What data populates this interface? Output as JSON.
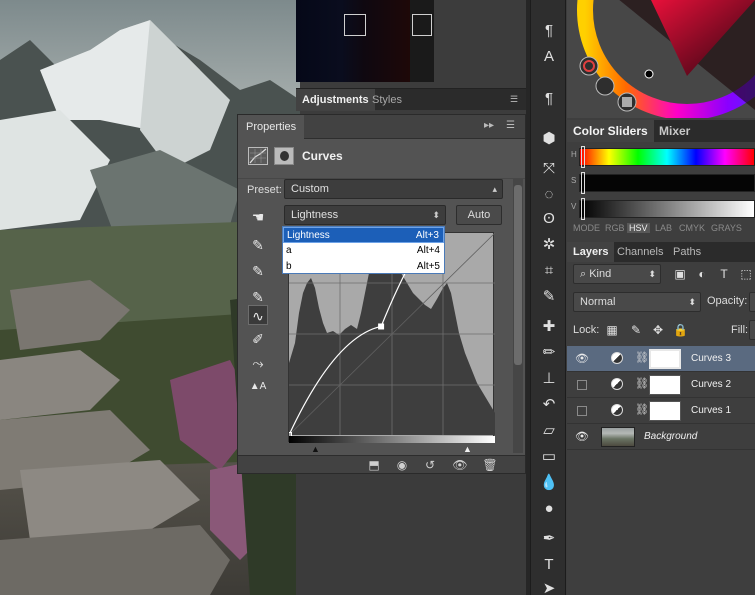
{
  "adjustments_tabs": {
    "active": "Adjustments",
    "inactive": "Styles"
  },
  "properties": {
    "title": "Properties",
    "panel_name": "Curves",
    "preset_label": "Preset:",
    "preset_value": "Custom",
    "channel_value": "Lightness",
    "auto_button": "Auto",
    "channel_menu": [
      {
        "label": "Lightness",
        "shortcut": "Alt+3",
        "highlighted": true
      },
      {
        "label": "a",
        "shortcut": "Alt+4",
        "highlighted": false
      },
      {
        "label": "b",
        "shortcut": "Alt+5",
        "highlighted": false
      }
    ],
    "curve_points": [
      {
        "input": 0,
        "output": 0
      },
      {
        "input": 114,
        "output": 137
      },
      {
        "input": 172,
        "output": 255
      }
    ]
  },
  "color_panel": {
    "tabs": {
      "active": "Color Sliders",
      "inactive": "Mixer"
    },
    "slider_labels": [
      "H",
      "S",
      "V"
    ],
    "modes": [
      "MODE",
      "RGB",
      "HSV",
      "LAB",
      "CMYK",
      "GRAYS"
    ],
    "active_mode": "HSV"
  },
  "layers_panel": {
    "tabs": [
      "Layers",
      "Channels",
      "Paths"
    ],
    "filter_value": "Kind",
    "blend_mode": "Normal",
    "opacity_label": "Opacity:",
    "lock_label": "Lock:",
    "fill_label": "Fill:",
    "layers": [
      {
        "name": "Curves 3",
        "visible": true,
        "selected": true
      },
      {
        "name": "Curves 2",
        "visible": false,
        "selected": false
      },
      {
        "name": "Curves 1",
        "visible": false,
        "selected": false
      }
    ],
    "background_name": "Background"
  },
  "colors": {
    "accent": "#1c5fb8",
    "panel": "#535353",
    "dark": "#2e2e2e"
  }
}
